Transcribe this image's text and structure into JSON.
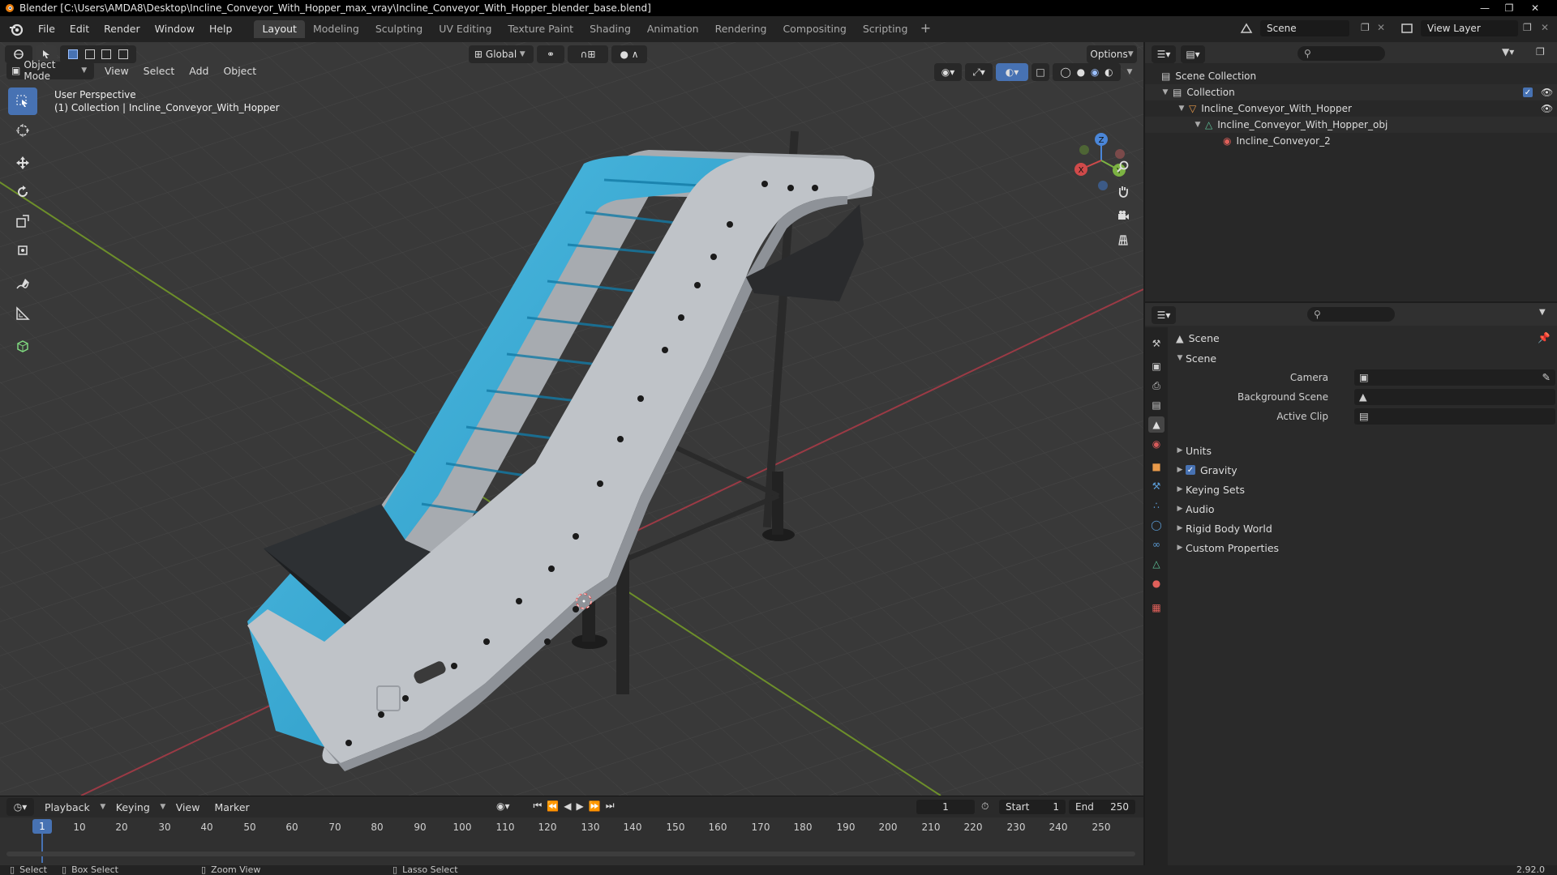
{
  "window": {
    "title": "Blender [C:\\Users\\AMDA8\\Desktop\\Incline_Conveyor_With_Hopper_max_vray\\Incline_Conveyor_With_Hopper_blender_base.blend]"
  },
  "menu": {
    "file": "File",
    "edit": "Edit",
    "render": "Render",
    "window": "Window",
    "help": "Help"
  },
  "workspaces": [
    "Layout",
    "Modeling",
    "Sculpting",
    "UV Editing",
    "Texture Paint",
    "Shading",
    "Animation",
    "Rendering",
    "Compositing",
    "Scripting"
  ],
  "scene_selector": {
    "scene": "Scene",
    "view_layer": "View Layer"
  },
  "viewport": {
    "mode": "Object Mode",
    "menus": {
      "view": "View",
      "select": "Select",
      "add": "Add",
      "object": "Object"
    },
    "transform_orientation": "Global",
    "options": "Options",
    "overlay_line1": "User Perspective",
    "overlay_line2": "(1) Collection | Incline_Conveyor_With_Hopper",
    "gizmo": {
      "x": "X",
      "y": "Y",
      "z": "Z"
    }
  },
  "timeline": {
    "playback": "Playback",
    "keying": "Keying",
    "view": "View",
    "marker": "Marker",
    "current_frame": "1",
    "start_label": "Start",
    "start": "1",
    "end_label": "End",
    "end": "250",
    "ticks": [
      "1",
      "10",
      "20",
      "30",
      "40",
      "50",
      "60",
      "70",
      "80",
      "90",
      "100",
      "110",
      "120",
      "130",
      "140",
      "150",
      "160",
      "170",
      "180",
      "190",
      "200",
      "210",
      "220",
      "230",
      "240",
      "250"
    ]
  },
  "outliner": {
    "rows": [
      "Scene Collection",
      "Collection",
      "Incline_Conveyor_With_Hopper",
      "Incline_Conveyor_With_Hopper_obj",
      "Incline_Conveyor_2"
    ]
  },
  "properties": {
    "context": "Scene",
    "panel": "Scene",
    "camera_label": "Camera",
    "background_scene_label": "Background Scene",
    "active_clip_label": "Active Clip",
    "sections": [
      "Units",
      "Gravity",
      "Keying Sets",
      "Audio",
      "Rigid Body World",
      "Custom Properties"
    ],
    "gravity_checked": true
  },
  "status": {
    "select": "Select",
    "box_select": "Box Select",
    "zoom_view": "Zoom View",
    "lasso_select": "Lasso Select",
    "version": "2.92.0"
  },
  "colors": {
    "accent": "#4772b3",
    "belt": "#2fa3cc",
    "frame": "#b8bcc2",
    "x_axis": "#9b3a45",
    "y_axis": "#6d8f2a"
  }
}
